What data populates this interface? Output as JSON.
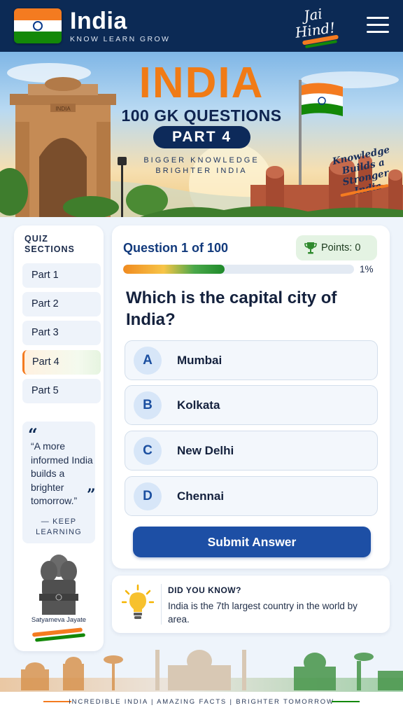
{
  "header": {
    "title": "India",
    "tagline": "KNOW  LEARN  GROW",
    "jai_hind": "Jai Hind!",
    "flag_icon": "india-flag-icon",
    "menu_icon": "hamburger-menu-icon"
  },
  "hero": {
    "title": "INDIA",
    "subtitle": "100 GK QUESTIONS",
    "part_badge": "PART 4",
    "line1": "BIGGER KNOWLEDGE",
    "line2": "BRIGHTER INDIA",
    "side_note": "Knowledge Builds a Stronger India",
    "gate_inscription": "INDIA"
  },
  "sidebar": {
    "title_line1": "QUIZ",
    "title_line2": "SECTIONS",
    "items": [
      {
        "label": "Part 1",
        "active": false
      },
      {
        "label": "Part 2",
        "active": false
      },
      {
        "label": "Part 3",
        "active": false
      },
      {
        "label": "Part 4",
        "active": true
      },
      {
        "label": "Part 5",
        "active": false
      }
    ],
    "quote": "“A more informed India builds a brighter tomorrow.”",
    "quote_by_line1": "— KEEP",
    "quote_by_line2": "LEARNING",
    "emblem_caption": "Satyameva Jayate"
  },
  "quiz": {
    "counter": "Question 1 of 100",
    "points_label": "Points: 0",
    "progress_percent": 44,
    "progress_text": "1%",
    "question": "Which is the capital city of India?",
    "options": [
      {
        "letter": "A",
        "label": "Mumbai"
      },
      {
        "letter": "B",
        "label": "Kolkata"
      },
      {
        "letter": "C",
        "label": "New Delhi"
      },
      {
        "letter": "D",
        "label": "Chennai"
      }
    ],
    "submit_label": "Submit Answer"
  },
  "did_you_know": {
    "title": "DID YOU KNOW?",
    "text": "India is the 7th largest country in the world by area."
  },
  "footer": {
    "text": "INCREDIBLE INDIA  |  AMAZING FACTS  |  BRIGHTER TOMORROW"
  },
  "colors": {
    "navy": "#0c2a55",
    "saffron": "#f47b20",
    "green": "#138808",
    "primary_button": "#1d4fa5",
    "accent_blue": "#123a7c"
  }
}
